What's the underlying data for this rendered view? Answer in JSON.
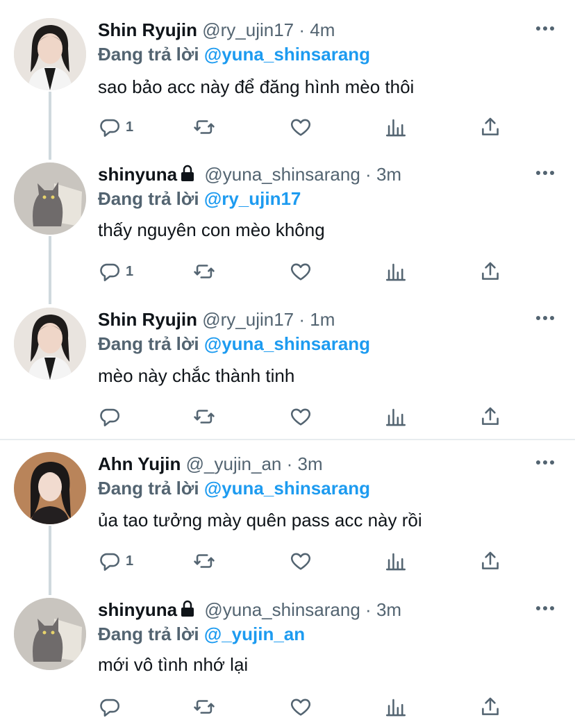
{
  "tweets": [
    {
      "name": "Shin Ryujin",
      "handle": "@ry_ujin17",
      "separator": "·",
      "time": "4m",
      "locked": false,
      "reply_prefix": "Đang trả lời",
      "reply_to": "@yuna_shinsarang",
      "text": "sao bảo acc này để đăng hình mèo thôi",
      "reply_count": "1",
      "avatar": "person-avatar"
    },
    {
      "name": "shinyuna",
      "handle": "@yuna_shinsarang",
      "separator": "·",
      "time": "3m",
      "locked": true,
      "reply_prefix": "Đang trả lời",
      "reply_to": "@ry_ujin17",
      "text": "thấy nguyên con mèo không",
      "reply_count": "1",
      "avatar": "cat-avatar"
    },
    {
      "name": "Shin Ryujin",
      "handle": "@ry_ujin17",
      "separator": "·",
      "time": "1m",
      "locked": false,
      "reply_prefix": "Đang trả lời",
      "reply_to": "@yuna_shinsarang",
      "text": "mèo này chắc thành tinh",
      "reply_count": "",
      "avatar": "person-avatar"
    },
    {
      "name": "Ahn Yujin",
      "handle": "@_yujin_an",
      "separator": "·",
      "time": "3m",
      "locked": false,
      "reply_prefix": "Đang trả lời",
      "reply_to": "@yuna_shinsarang",
      "text": "ủa tao tưởng mày quên pass acc này rồi",
      "reply_count": "1",
      "avatar": "person-avatar-2"
    },
    {
      "name": "shinyuna",
      "handle": "@yuna_shinsarang",
      "separator": "·",
      "time": "3m",
      "locked": true,
      "reply_prefix": "Đang trả lời",
      "reply_to": "@_yujin_an",
      "text": "mới vô tình nhớ lại",
      "reply_count": "",
      "avatar": "cat-avatar"
    }
  ],
  "colors": {
    "link": "#1d9bf0",
    "secondary": "#536471",
    "thread_line": "#cfd9de"
  },
  "icons": [
    "reply-icon",
    "retweet-icon",
    "like-icon",
    "analytics-icon",
    "share-icon",
    "more-icon",
    "lock-icon"
  ]
}
